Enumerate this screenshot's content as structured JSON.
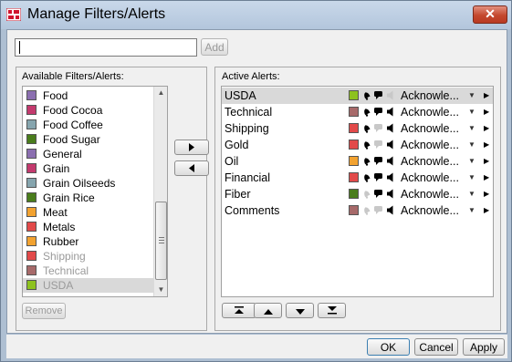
{
  "window": {
    "title": "Manage Filters/Alerts",
    "close_label": "✕"
  },
  "top": {
    "input_value": "",
    "add_label": "Add"
  },
  "available": {
    "label": "Available Filters/Alerts:",
    "items": [
      {
        "name": "Food",
        "color": "#8b6fb0",
        "state": "normal"
      },
      {
        "name": "Food Cocoa",
        "color": "#c43a6e",
        "state": "normal"
      },
      {
        "name": "Food Coffee",
        "color": "#86a5ae",
        "state": "normal"
      },
      {
        "name": "Food Sugar",
        "color": "#4a7d1c",
        "state": "normal"
      },
      {
        "name": "General",
        "color": "#8b6fb0",
        "state": "normal"
      },
      {
        "name": "Grain",
        "color": "#c43a6e",
        "state": "normal"
      },
      {
        "name": "Grain Oilseeds",
        "color": "#86a5ae",
        "state": "normal"
      },
      {
        "name": "Grain Rice",
        "color": "#4a7d1c",
        "state": "normal"
      },
      {
        "name": "Meat",
        "color": "#f2a230",
        "state": "normal"
      },
      {
        "name": "Metals",
        "color": "#e24a4a",
        "state": "normal"
      },
      {
        "name": "Rubber",
        "color": "#f2a230",
        "state": "normal"
      },
      {
        "name": "Shipping",
        "color": "#e24a4a",
        "state": "disabled"
      },
      {
        "name": "Technical",
        "color": "#a76a6a",
        "state": "disabled"
      },
      {
        "name": "USDA",
        "color": "#8dc21f",
        "state": "disabled-selected"
      }
    ],
    "remove_label": "Remove"
  },
  "active": {
    "label": "Active Alerts:",
    "items": [
      {
        "name": "USDA",
        "color": "#8dc21f",
        "bell": true,
        "msg": true,
        "sound": false,
        "ack": "Acknowle...",
        "selected": true
      },
      {
        "name": "Technical",
        "color": "#a76a6a",
        "bell": true,
        "msg": true,
        "sound": true,
        "ack": "Acknowle...",
        "selected": false
      },
      {
        "name": "Shipping",
        "color": "#e24a4a",
        "bell": true,
        "msg": false,
        "sound": true,
        "ack": "Acknowle...",
        "selected": false
      },
      {
        "name": "Gold",
        "color": "#e24a4a",
        "bell": true,
        "msg": false,
        "sound": true,
        "ack": "Acknowle...",
        "selected": false
      },
      {
        "name": "Oil",
        "color": "#f2a230",
        "bell": true,
        "msg": true,
        "sound": true,
        "ack": "Acknowle...",
        "selected": false
      },
      {
        "name": "Financial",
        "color": "#e24a4a",
        "bell": true,
        "msg": true,
        "sound": true,
        "ack": "Acknowle...",
        "selected": false
      },
      {
        "name": "Fiber",
        "color": "#4a7d1c",
        "bell": false,
        "msg": true,
        "sound": true,
        "ack": "Acknowle...",
        "selected": false
      },
      {
        "name": "Comments",
        "color": "#a76a6a",
        "bell": false,
        "msg": false,
        "sound": true,
        "ack": "Acknowle...",
        "selected": false
      }
    ]
  },
  "transfer": {
    "right_icon": "triangle-right",
    "left_icon": "triangle-left"
  },
  "bottom": {
    "ok_label": "OK",
    "cancel_label": "Cancel",
    "apply_label": "Apply"
  }
}
